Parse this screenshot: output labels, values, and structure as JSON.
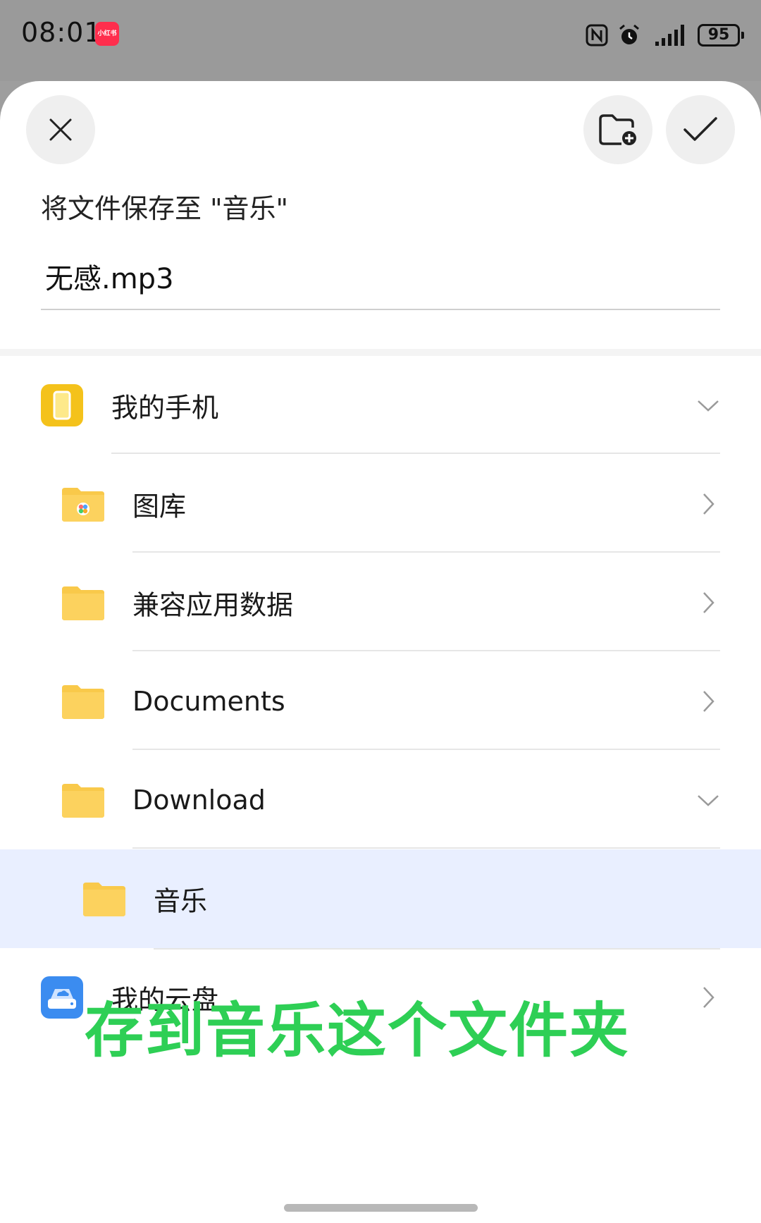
{
  "status": {
    "time": "08:01",
    "app_badge": "小红书",
    "battery": "95",
    "icons": [
      "nfc-icon",
      "alarm-icon",
      "signal-icon",
      "battery-icon"
    ]
  },
  "dialog": {
    "title": "将文件保存至 \"音乐\"",
    "filename": "无感.mp3"
  },
  "tree": {
    "phone": {
      "label": "我的手机",
      "expanded": true
    },
    "items": [
      {
        "label": "图库",
        "chevron": "right"
      },
      {
        "label": "兼容应用数据",
        "chevron": "right"
      },
      {
        "label": "Documents",
        "chevron": "right"
      },
      {
        "label": "Download",
        "chevron": "down"
      }
    ],
    "selected": {
      "label": "音乐"
    },
    "cloud": {
      "label": "我的云盘",
      "chevron": "right"
    }
  },
  "caption": "存到音乐这个文件夹",
  "colors": {
    "folder": "#f9c94a",
    "phone_icon": "#f4c21b",
    "cloud_icon": "#3b8cf0",
    "selected_bg": "#e9efff",
    "caption": "#2ecf55"
  }
}
